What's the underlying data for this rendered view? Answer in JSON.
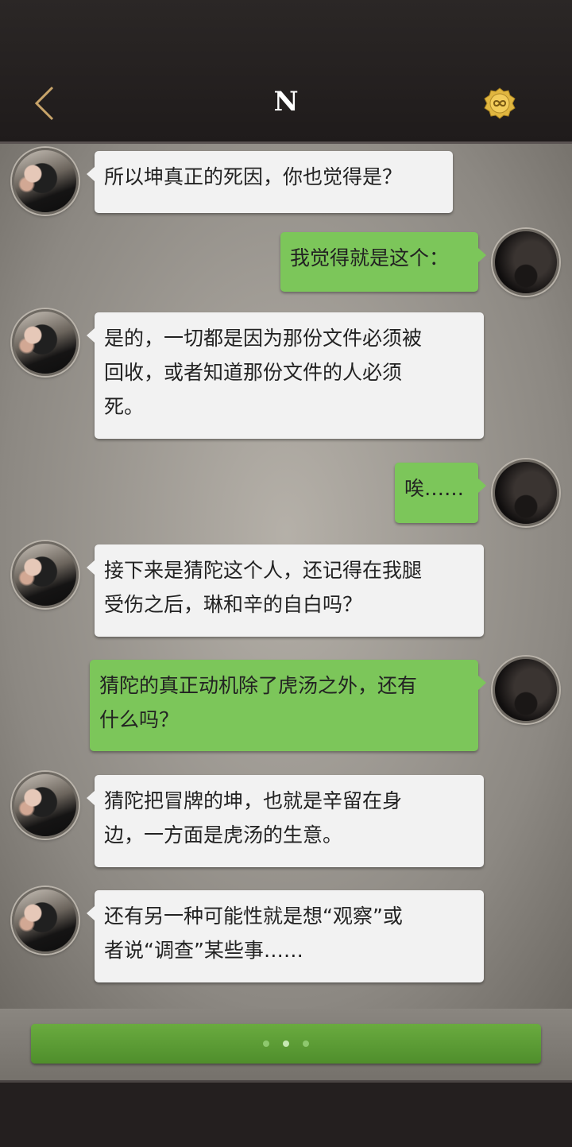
{
  "header": {
    "title": "N",
    "back_icon": "chevron-left-icon",
    "badge_icon": "infinity-coin-icon",
    "accent_color": "#c8a46a"
  },
  "messages": [
    {
      "side": "left",
      "text": "所以坤真正的死因，你也觉得是？"
    },
    {
      "side": "right",
      "text": "我觉得就是这个："
    },
    {
      "side": "left",
      "lines": [
        "是的，一切都是因为那份文件必须被",
        "回收，或者知道那份文件的人必须",
        "死。"
      ]
    },
    {
      "side": "right",
      "text": "唉……"
    },
    {
      "side": "left",
      "lines": [
        "接下来是猜陀这个人，还记得在我腿",
        "受伤之后，琳和辛的自白吗？"
      ]
    },
    {
      "side": "right",
      "lines": [
        "猜陀的真正动机除了虎汤之外，还有",
        "什么吗？"
      ]
    },
    {
      "side": "left",
      "lines": [
        "猜陀把冒牌的坤，也就是辛留在身",
        "边，一方面是虎汤的生意。"
      ]
    },
    {
      "side": "left",
      "lines": [
        "还有另一种可能性就是想“观察”或",
        "者说“调查”某些事……"
      ]
    }
  ],
  "input": {
    "typing_dots": 3,
    "button_color": "#5e9e36"
  },
  "colors": {
    "incoming_bubble": "#f2f2f2",
    "outgoing_bubble": "#7cc65a",
    "bar": "#241f1f"
  }
}
